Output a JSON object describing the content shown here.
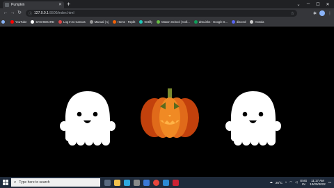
{
  "browser": {
    "tab": {
      "title": "Pumpkin"
    },
    "url": {
      "host": "127.0.0.1",
      "path": ":5500/index.html"
    },
    "bookmarks": [
      {
        "label": "YouTube",
        "color": "#ff0000"
      },
      {
        "label": "DASHBOARD",
        "color": "#ffffff"
      },
      {
        "label": "Log In to Canvas",
        "color": "#d44"
      },
      {
        "label": "Manual | sj",
        "color": "#999"
      },
      {
        "label": "Home - Replit",
        "color": "#f26207"
      },
      {
        "label": "Netlify",
        "color": "#20c6b7"
      },
      {
        "label": "Mason School | Coll...",
        "color": "#6b4"
      },
      {
        "label": "dnsLinks - Google S...",
        "color": "#0f9d58"
      },
      {
        "label": "discord",
        "color": "#5865f2"
      },
      {
        "label": "Hosola",
        "color": "#ccc"
      }
    ]
  },
  "colors": {
    "ghost": "#ffffff",
    "pumpkin_dark": "#c2410c",
    "pumpkin_light": "#f08a24",
    "pumpkin_face": "#ffb347",
    "stem": "#7a8a2e"
  },
  "taskbar": {
    "search_placeholder": "Type here to search",
    "weather": "26°C",
    "lang_top": "ENG",
    "lang_bottom": "IN",
    "time": "11:17 AM",
    "date": "10/20/2022"
  }
}
